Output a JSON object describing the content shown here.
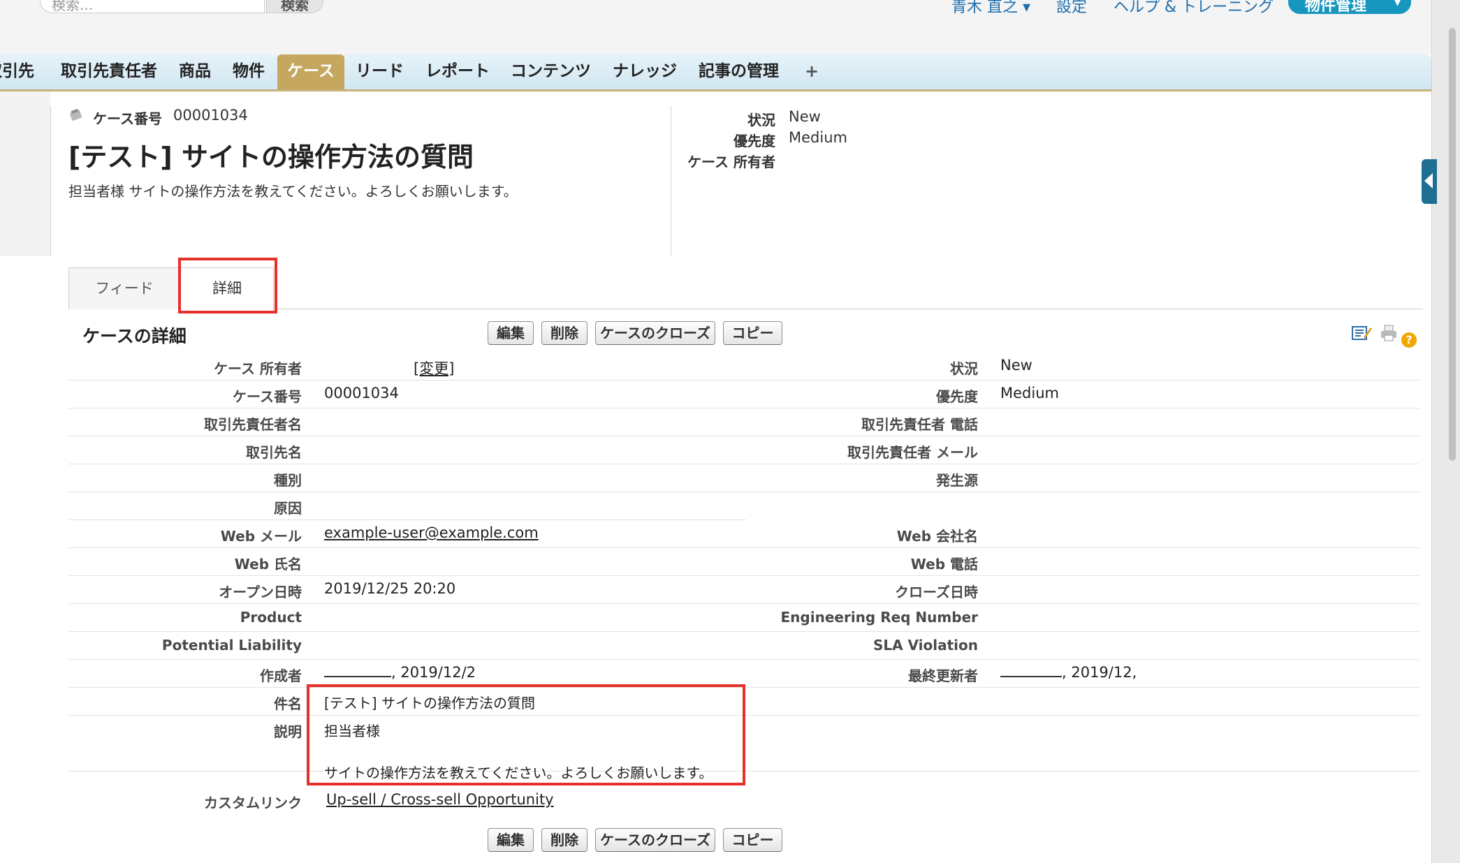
{
  "header": {
    "search_placeholder": "検索...",
    "search_button": "検索",
    "user_name": "青木 直之",
    "settings": "設定",
    "help": "ヘルプ & トレーニング",
    "app_menu": "物件管理"
  },
  "tabs": [
    {
      "label": "取引先"
    },
    {
      "label": "取引先責任者"
    },
    {
      "label": "商品"
    },
    {
      "label": "物件"
    },
    {
      "label": "ケース"
    },
    {
      "label": "リード"
    },
    {
      "label": "レポート"
    },
    {
      "label": "コンテンツ"
    },
    {
      "label": "ナレッジ"
    },
    {
      "label": "記事の管理"
    },
    {
      "label": "+"
    }
  ],
  "case_header": {
    "case_number_label": "ケース番号",
    "case_number": "00001034",
    "title": "[テスト] サイトの操作方法の質問",
    "summary": "担当者様 サイトの操作方法を教えてください。よろしくお願いします。",
    "status_label": "状況",
    "status": "New",
    "priority_label": "優先度",
    "priority": "Medium",
    "owner_label": "ケース 所有者"
  },
  "view_tabs": {
    "feed": "フィード",
    "detail": "詳細"
  },
  "detail": {
    "section_title": "ケースの詳細",
    "buttons": {
      "edit": "編集",
      "delete": "削除",
      "close_case": "ケースのクローズ",
      "copy": "コピー"
    },
    "change_link": "[変更]",
    "left": [
      {
        "label": "ケース 所有者",
        "value": ""
      },
      {
        "label": "ケース番号",
        "value": "00001034"
      },
      {
        "label": "取引先責任者名",
        "value": ""
      },
      {
        "label": "取引先名",
        "value": ""
      },
      {
        "label": "種別",
        "value": ""
      },
      {
        "label": "原因",
        "value": ""
      },
      {
        "label": "Web メール",
        "value": "example-user@example.com"
      },
      {
        "label": "Web 氏名",
        "value": ""
      },
      {
        "label": "オープン日時",
        "value": "2019/12/25 20:20"
      },
      {
        "label": "Product",
        "value": ""
      },
      {
        "label": "Potential Liability",
        "value": ""
      },
      {
        "label": "作成者",
        "value": ", 2019/12/2"
      }
    ],
    "right": [
      {
        "label": "状況",
        "value": "New"
      },
      {
        "label": "優先度",
        "value": "Medium"
      },
      {
        "label": "取引先責任者 電話",
        "value": ""
      },
      {
        "label": "取引先責任者 メール",
        "value": ""
      },
      {
        "label": "発生源",
        "value": ""
      },
      {
        "label": "",
        "value": ""
      },
      {
        "label": "Web 会社名",
        "value": ""
      },
      {
        "label": "Web 電話",
        "value": ""
      },
      {
        "label": "クローズ日時",
        "value": ""
      },
      {
        "label": "Engineering Req Number",
        "value": ""
      },
      {
        "label": "SLA Violation",
        "value": ""
      },
      {
        "label": "最終更新者",
        "value": ", 2019/12,"
      }
    ],
    "subject_label": "件名",
    "subject": "[テスト] サイトの操作方法の質問",
    "description_label": "説明",
    "description_line1": "担当者様",
    "description_line2": "サイトの操作方法を教えてください。よろしくお願いします。",
    "custom_link_label": "カスタムリンク",
    "custom_link": "Up-sell / Cross-sell Opportunity"
  }
}
